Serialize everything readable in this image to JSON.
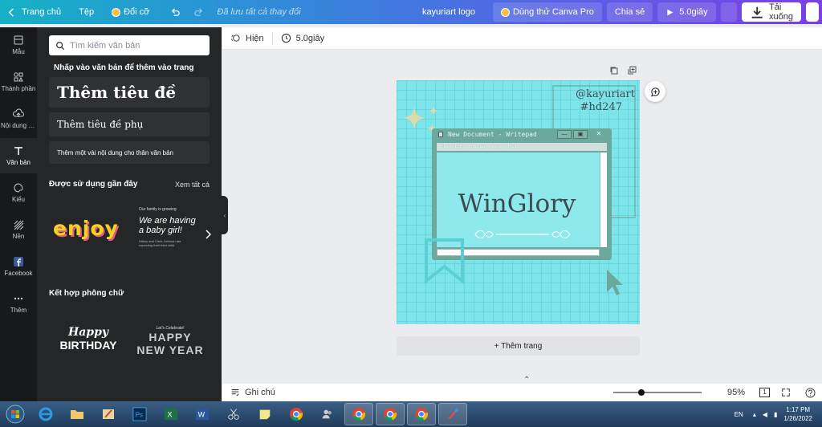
{
  "topbar": {
    "home_label": "Trang chủ",
    "file_label": "Tệp",
    "resize_label": "Đổi cỡ",
    "saved_status": "Đã lưu tất cả thay đổi",
    "doc_title": "kayuriart logo",
    "try_pro_label": "Dùng thử Canva Pro",
    "share_label": "Chia sẻ",
    "play_label": "5.0giây",
    "download_label": "Tải xuống"
  },
  "rail": [
    {
      "label": "Mẫu",
      "icon": "template-icon"
    },
    {
      "label": "Thành phần",
      "icon": "elements-icon"
    },
    {
      "label": "Nội dung tải lên",
      "icon": "upload-icon"
    },
    {
      "label": "Văn bản",
      "icon": "text-icon"
    },
    {
      "label": "Kiểu",
      "icon": "styles-icon"
    },
    {
      "label": "Nền",
      "icon": "background-icon"
    },
    {
      "label": "Facebook",
      "icon": "facebook-icon"
    },
    {
      "label": "Thêm",
      "icon": "more-icon"
    }
  ],
  "panel": {
    "search_placeholder": "Tìm kiếm văn bản",
    "hint": "Nhấp vào văn bản để thêm vào trang",
    "heading": "Thêm tiêu đề",
    "subheading": "Thêm tiêu đề phụ",
    "body": "Thêm một vài nội dung cho thân văn bản",
    "recent_title": "Được sử dụng gần đây",
    "see_all": "Xem tất cả",
    "combo_title": "Kết hợp phông chữ",
    "thumbs": {
      "enjoy": "enjoy",
      "family_top": "Our family is growing",
      "baby_line1": "We are having",
      "baby_line2": "a baby girl!",
      "baby_small": "Hillary and Chris Johnson are expecting their third child",
      "happy": "Happy",
      "birthday": "BIRTHDAY",
      "celebrate": "Let's Celebrate!",
      "happy2": "HAPPY",
      "newyear": "NEW YEAR"
    }
  },
  "editor_toolbar": {
    "anim_label": "Hiện",
    "time_label": "5.0giây"
  },
  "design": {
    "handle_line1": "@kayuriart",
    "handle_line2": "#hd247",
    "window_title": "New Document - Writepad",
    "menu": [
      "File",
      "Edit",
      "Format",
      "View",
      "Help"
    ],
    "main_text": "WinGlory"
  },
  "add_page_label": "+ Thêm trang",
  "statusbar": {
    "notes_label": "Ghi chú",
    "zoom_level": "95%",
    "zoom_fraction": 0.3,
    "page_number": "1"
  },
  "taskbar": {
    "lang": "EN",
    "time": "1:17 PM",
    "date": "1/26/2022"
  },
  "colors": {
    "canvas_bg": "#7de5ea",
    "window_frame": "#6aa99c",
    "text_dark": "#3d4a50"
  }
}
